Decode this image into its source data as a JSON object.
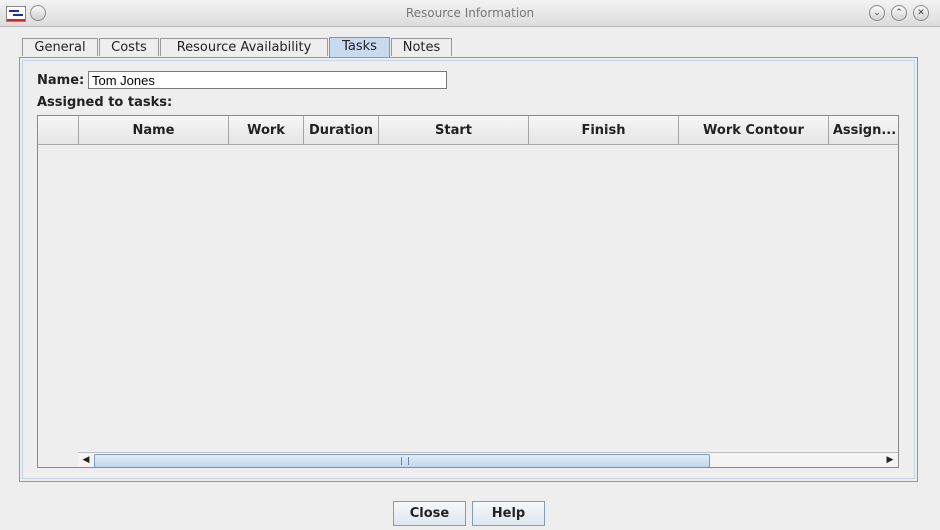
{
  "window": {
    "title": "Resource Information"
  },
  "tabs": [
    {
      "label": "General"
    },
    {
      "label": "Costs"
    },
    {
      "label": "Resource Availability"
    },
    {
      "label": "Tasks",
      "active": true
    },
    {
      "label": "Notes"
    }
  ],
  "form": {
    "name_label": "Name:",
    "name_value": "Tom Jones",
    "assigned_label": "Assigned to tasks:"
  },
  "table": {
    "columns": [
      "",
      "Name",
      "Work",
      "Duration",
      "Start",
      "Finish",
      "Work Contour",
      "Assign..."
    ],
    "rows": []
  },
  "buttons": {
    "close": "Close",
    "help": "Help"
  },
  "icons": {
    "minimize": "chevron-down-icon",
    "maximize": "chevron-up-icon",
    "close": "close-icon",
    "scroll_left": "arrow-left-icon",
    "scroll_right": "arrow-right-icon"
  },
  "colors": {
    "active_tab": "#c9daf0",
    "panel_border": "#7f9db9"
  }
}
